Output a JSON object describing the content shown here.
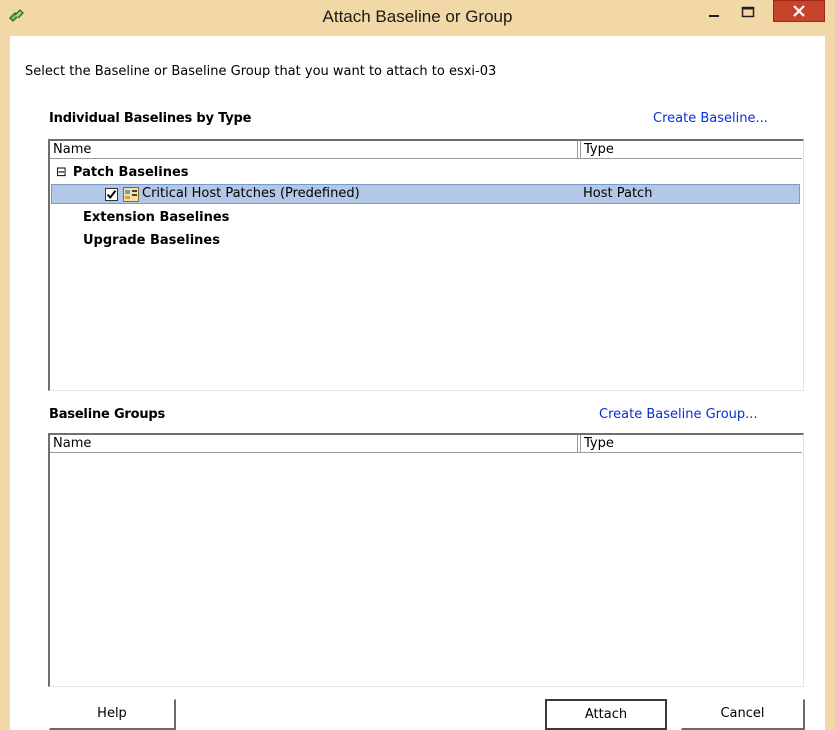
{
  "window": {
    "title": "Attach Baseline or Group"
  },
  "instruction": "Select the Baseline or Baseline Group that you want to attach to esxi-03",
  "individual": {
    "heading": "Individual Baselines by Type",
    "create_link": "Create Baseline...",
    "columns": [
      "Name",
      "Type"
    ],
    "groups": [
      {
        "label": "Patch Baselines",
        "expanded": true,
        "expander": "⊟"
      },
      {
        "label": "Extension Baselines"
      },
      {
        "label": "Upgrade Baselines"
      }
    ],
    "items": [
      {
        "name": "Critical Host Patches (Predefined)",
        "type": "Host Patch",
        "checked": true,
        "selected": true
      }
    ]
  },
  "groups_section": {
    "heading": "Baseline Groups",
    "create_link": "Create Baseline Group...",
    "columns": [
      "Name",
      "Type"
    ]
  },
  "buttons": {
    "help": "Help",
    "attach": "Attach",
    "cancel": "Cancel"
  },
  "colors": {
    "titlebar": "#f1d8a6",
    "selection": "#b3c8e6",
    "link": "#0b2fd6",
    "close": "#c7432b"
  },
  "icons": {
    "app": "link-icon",
    "checkbox_checked": "checkmark",
    "baseline": "baseline-icon"
  }
}
